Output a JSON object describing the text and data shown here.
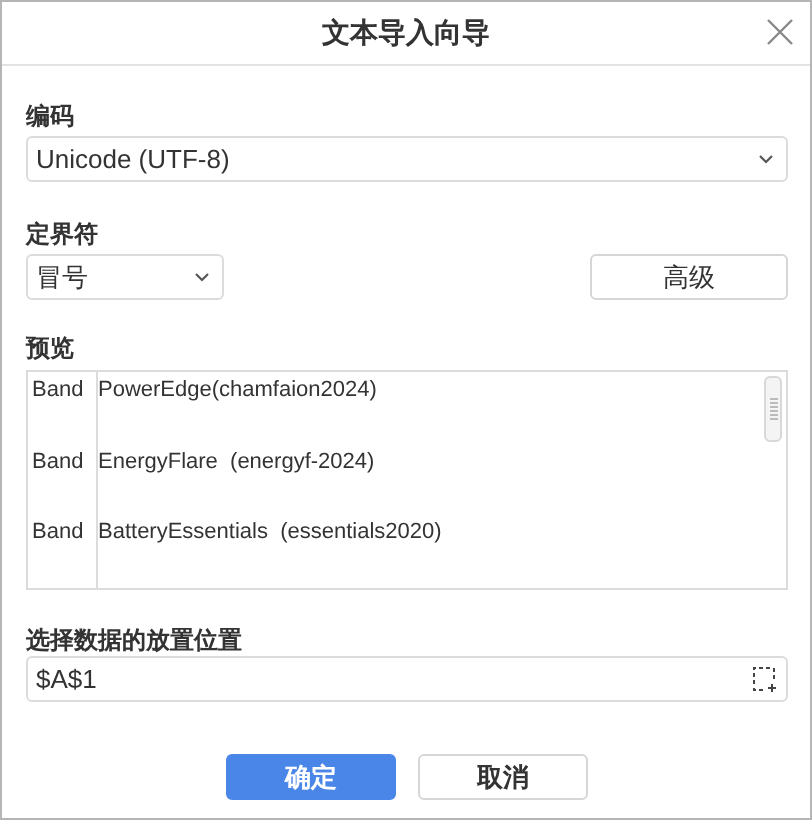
{
  "window": {
    "title": "文本导入向导"
  },
  "encoding": {
    "label": "编码",
    "value": "Unicode (UTF-8)"
  },
  "delimiter": {
    "label": "定界符",
    "value": "冒号",
    "advanced_button": "高级"
  },
  "preview": {
    "label": "预览",
    "rows": [
      {
        "column_1": "Band",
        "column_2": "PowerEdge(chamfaion2024)"
      },
      {
        "column_1": "Band",
        "column_2": "EnergyFlare  (energyf-2024)"
      },
      {
        "column_1": "Band",
        "column_2": "BatteryEssentials  (essentials2020)"
      }
    ]
  },
  "destination": {
    "label": "选择数据的放置位置",
    "value": "$A$1"
  },
  "buttons": [
    {
      "label": "确定",
      "kind": "primary"
    },
    {
      "label": "取消",
      "kind": "secondary"
    }
  ]
}
